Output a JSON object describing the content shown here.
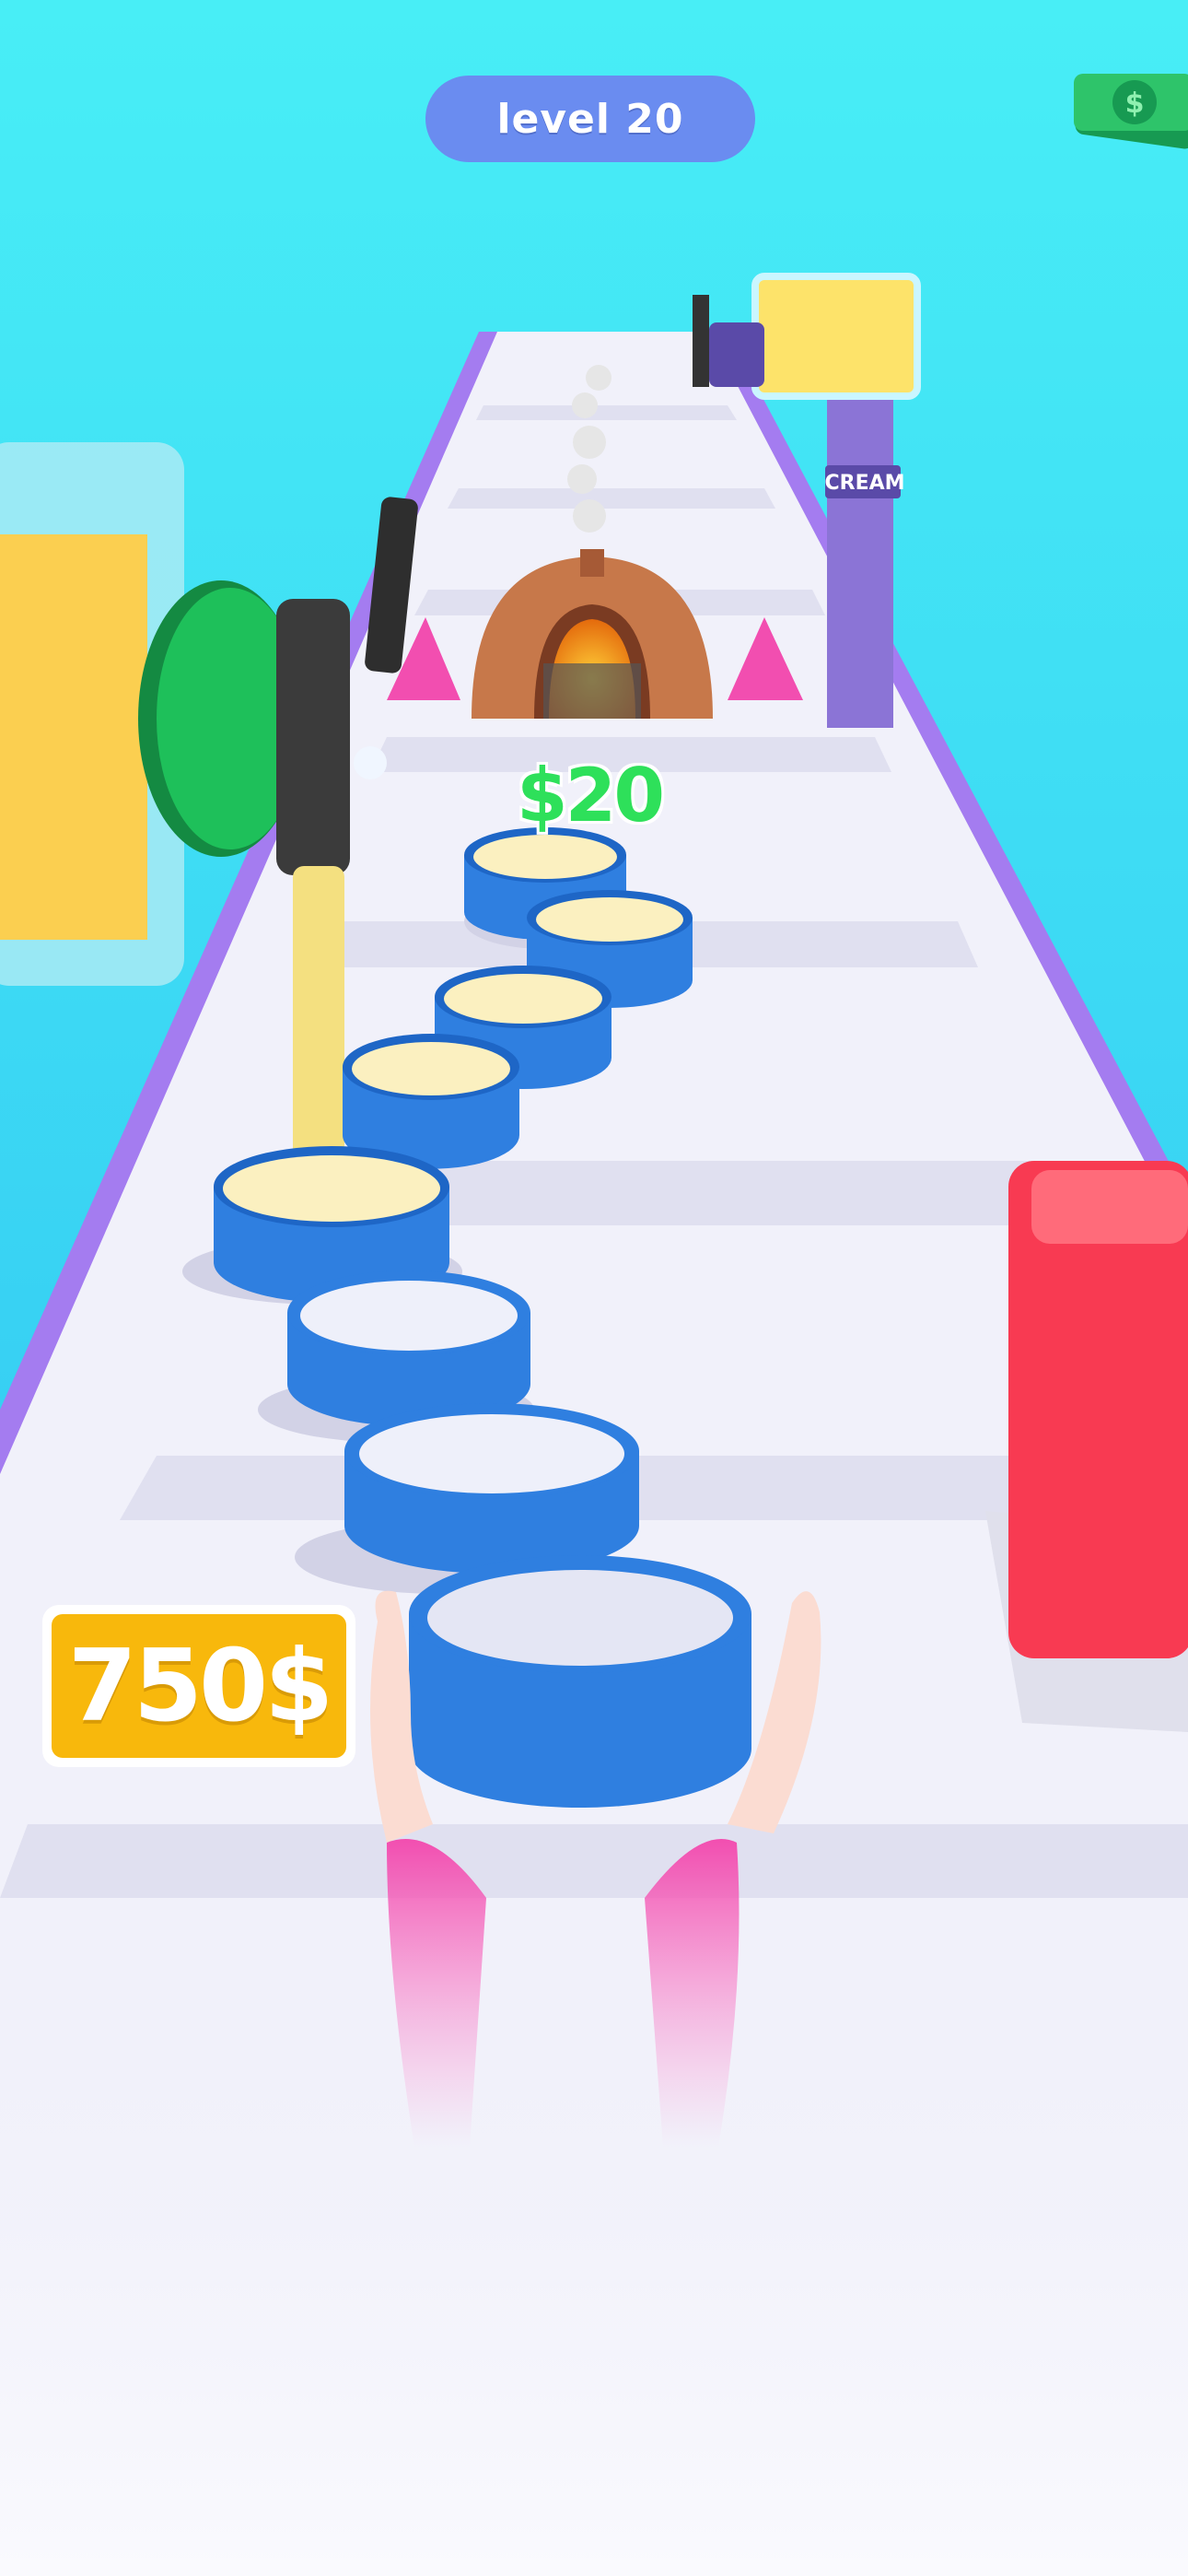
{
  "hud": {
    "level_label": "level 20",
    "currency_icon": "cash-stack-icon"
  },
  "score": {
    "money_label": "750$"
  },
  "world": {
    "oven_price": "$20",
    "cream_sign": "CREAM"
  },
  "colors": {
    "sky": "#48e3f2",
    "track": "#f1f1fa",
    "track_rail": "#a47cf0",
    "ring": "#2f7fe0",
    "batter": "#fbf0c0",
    "hud_pill": "#6a8cf0",
    "price_tag": "#f8b80c",
    "oven_price": "#2ee05a"
  },
  "scene": {
    "rings_with_batter": 5,
    "empty_rings": 3,
    "rings_held": 1
  }
}
